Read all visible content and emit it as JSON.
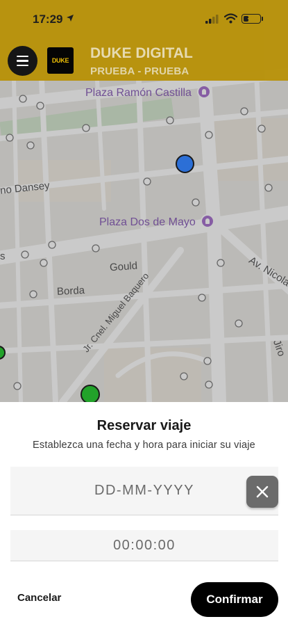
{
  "status_bar": {
    "time": "17:29",
    "battery": "33",
    "battery_level": 0.33
  },
  "header": {
    "title": "DUKE DIGITAL",
    "subtitle": "PRUEBA - PRUEBA",
    "logo_text": "DUKE",
    "accent_color": "#b8920a"
  },
  "map": {
    "places": [
      {
        "name": "Plaza Ramón Castilla"
      },
      {
        "name": "Plaza Dos de Mayo"
      }
    ],
    "streets": [
      "no Dansey",
      "Gould",
      "Borda",
      "Jr. Cnel. Miguel Baquero",
      "Av. Nicola",
      "Jiro",
      "s"
    ],
    "markers": [
      {
        "color": "#2c6fd6"
      },
      {
        "color": "#22a22a"
      },
      {
        "color": "#22a22a"
      }
    ]
  },
  "sheet": {
    "title": "Reservar viaje",
    "description": "Establezca una fecha y hora para iniciar su viaje",
    "date_placeholder": "DD-MM-YYYY",
    "time_placeholder": "00:00:00",
    "cancel_label": "Cancelar",
    "confirm_label": "Confirmar"
  }
}
